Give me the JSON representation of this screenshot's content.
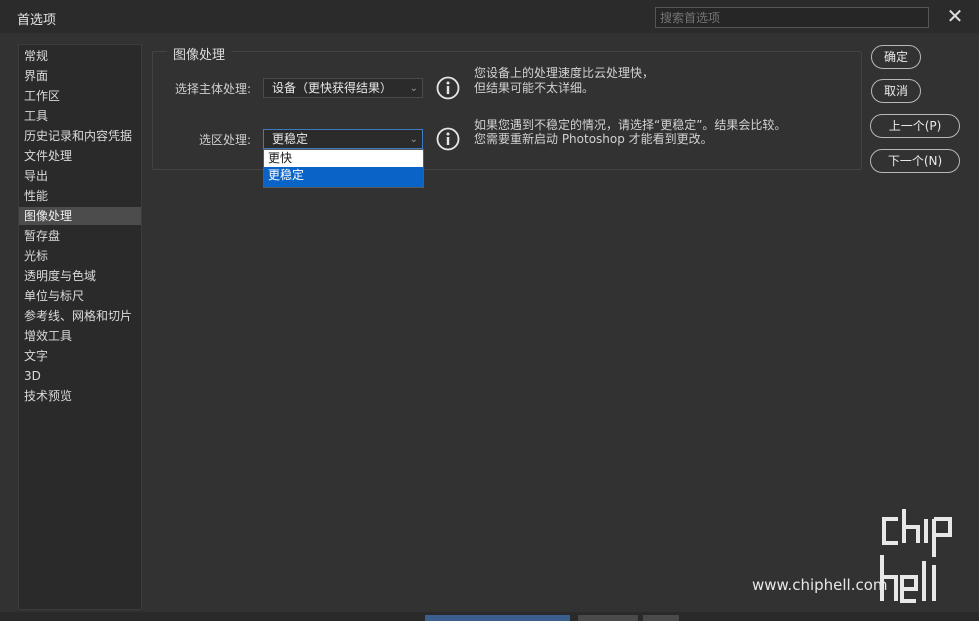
{
  "window": {
    "title": "首选项"
  },
  "search": {
    "placeholder": "搜索首选项"
  },
  "sidebar": {
    "items": [
      {
        "label": "常规",
        "active": false
      },
      {
        "label": "界面",
        "active": false
      },
      {
        "label": "工作区",
        "active": false
      },
      {
        "label": "工具",
        "active": false
      },
      {
        "label": "历史记录和内容凭据",
        "active": false
      },
      {
        "label": "文件处理",
        "active": false
      },
      {
        "label": "导出",
        "active": false
      },
      {
        "label": "性能",
        "active": false
      },
      {
        "label": "图像处理",
        "active": true
      },
      {
        "label": "暂存盘",
        "active": false
      },
      {
        "label": "光标",
        "active": false
      },
      {
        "label": "透明度与色域",
        "active": false
      },
      {
        "label": "单位与标尺",
        "active": false
      },
      {
        "label": "参考线、网格和切片",
        "active": false
      },
      {
        "label": "增效工具",
        "active": false
      },
      {
        "label": "文字",
        "active": false
      },
      {
        "label": "3D",
        "active": false
      },
      {
        "label": "技术预览",
        "active": false
      }
    ]
  },
  "section": {
    "title": "图像处理",
    "row1": {
      "label": "选择主体处理:",
      "value": "设备（更快获得结果）",
      "note_line1": "您设备上的处理速度比云处理快，",
      "note_line2": "但结果可能不太详细。"
    },
    "row2": {
      "label": "选区处理:",
      "value": "更稳定",
      "note_line1": "如果您遇到不稳定的情况，请选择“更稳定”。结果会比较。",
      "note_line2": "您需要重新启动 Photoshop 才能看到更改。",
      "options": [
        "更快",
        "更稳定"
      ],
      "selected_option": "更稳定"
    }
  },
  "buttons": {
    "ok": "确定",
    "cancel": "取消",
    "prev": "上一个(P)",
    "next": "下一个(N)"
  },
  "icons": {
    "close": "close-icon",
    "info": "info-icon",
    "chevron": "chevron-down-icon"
  },
  "colors": {
    "accent": "#0a64c8",
    "background": "#323232"
  },
  "watermark": {
    "text": "www.chiphell.com",
    "logo_text": "chip hell"
  }
}
